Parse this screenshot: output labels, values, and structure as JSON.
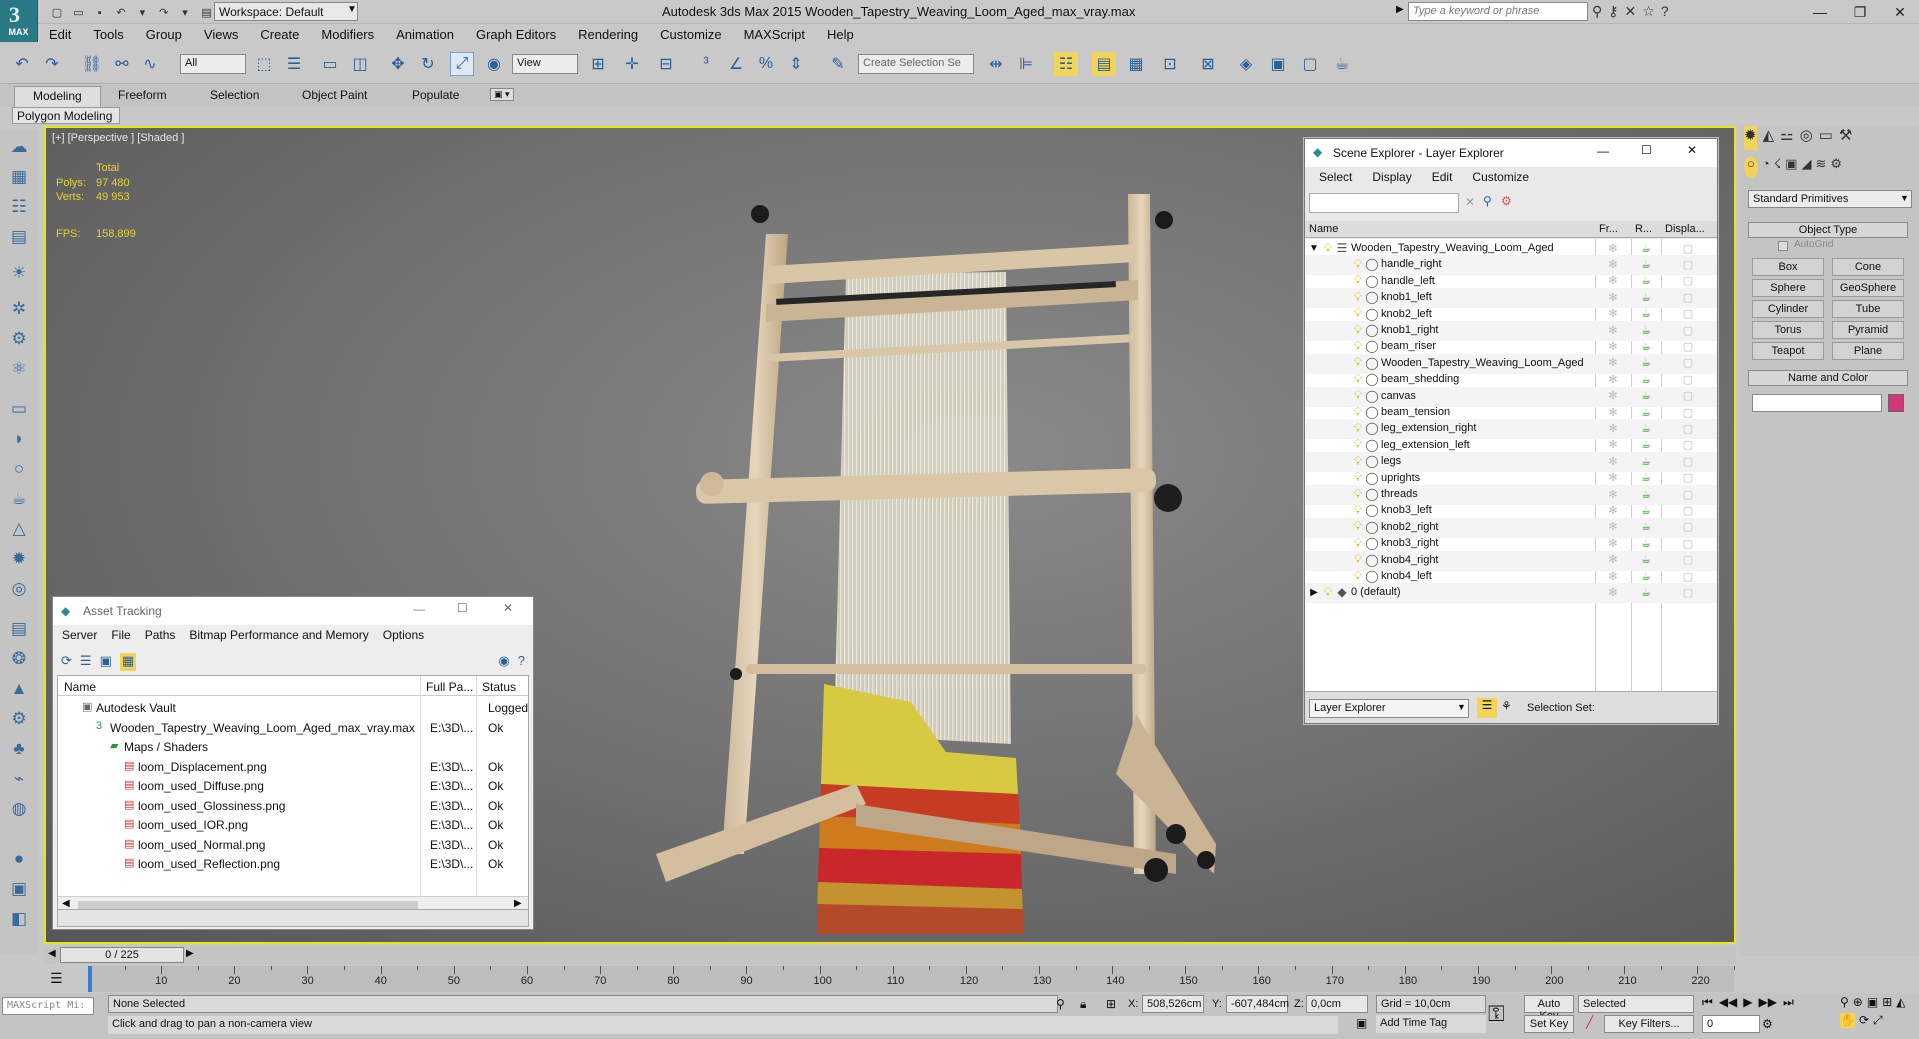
{
  "app": {
    "title": "Autodesk 3ds Max  2015     Wooden_Tapestry_Weaving_Loom_Aged_max_vray.max",
    "logo": "MAX",
    "workspace": "Workspace: Default",
    "search_placeholder": "Type a keyword or phrase"
  },
  "menu": [
    "Edit",
    "Tools",
    "Group",
    "Views",
    "Create",
    "Modifiers",
    "Animation",
    "Graph Editors",
    "Rendering",
    "Customize",
    "MAXScript",
    "Help"
  ],
  "toolbar": {
    "filter": "All",
    "refcoord": "View",
    "selection_set": "Create Selection Se"
  },
  "ribbon": {
    "tabs": [
      "Modeling",
      "Freeform",
      "Selection",
      "Object Paint",
      "Populate"
    ],
    "sub": "Polygon Modeling"
  },
  "viewport": {
    "label": "[+] [Perspective ] [Shaded ]",
    "stats": {
      "total_label": "Total",
      "polys_label": "Polys:",
      "polys": "97 480",
      "verts_label": "Verts:",
      "verts": "49 953",
      "fps_label": "FPS:",
      "fps": "158,899"
    }
  },
  "scene_explorer": {
    "title": "Scene Explorer - Layer Explorer",
    "menu": [
      "Select",
      "Display",
      "Edit",
      "Customize"
    ],
    "columns": {
      "name": "Name",
      "frozen": "Fr...",
      "render": "R...",
      "display": "Displa..."
    },
    "root": "Wooden_Tapestry_Weaving_Loom_Aged",
    "items": [
      "handle_right",
      "handle_left",
      "knob1_left",
      "knob2_left",
      "knob1_right",
      "beam_riser",
      "Wooden_Tapestry_Weaving_Loom_Aged",
      "beam_shedding",
      "canvas",
      "beam_tension",
      "leg_extension_right",
      "leg_extension_left",
      "legs",
      "uprights",
      "threads",
      "knob3_left",
      "knob2_right",
      "knob3_right",
      "knob4_right",
      "knob4_left"
    ],
    "default_layer": "0 (default)",
    "footer_mode": "Layer Explorer",
    "selection_set_label": "Selection Set:"
  },
  "asset_tracking": {
    "title": "Asset Tracking",
    "menu": [
      "Server",
      "File",
      "Paths",
      "Bitmap Performance and Memory",
      "Options"
    ],
    "columns": {
      "name": "Name",
      "full_path": "Full Pa...",
      "status": "Status"
    },
    "rows": [
      {
        "name": "Autodesk Vault",
        "path": "",
        "status": "Logged",
        "indent": 1
      },
      {
        "name": "Wooden_Tapestry_Weaving_Loom_Aged_max_vray.max",
        "path": "E:\\3D\\...",
        "status": "Ok",
        "indent": 2
      },
      {
        "name": "Maps / Shaders",
        "path": "",
        "status": "",
        "indent": 3
      },
      {
        "name": "loom_Displacement.png",
        "path": "E:\\3D\\...",
        "status": "Ok",
        "indent": 4
      },
      {
        "name": "loom_used_Diffuse.png",
        "path": "E:\\3D\\...",
        "status": "Ok",
        "indent": 4
      },
      {
        "name": "loom_used_Glossiness.png",
        "path": "E:\\3D\\...",
        "status": "Ok",
        "indent": 4
      },
      {
        "name": "loom_used_IOR.png",
        "path": "E:\\3D\\...",
        "status": "Ok",
        "indent": 4
      },
      {
        "name": "loom_used_Normal.png",
        "path": "E:\\3D\\...",
        "status": "Ok",
        "indent": 4
      },
      {
        "name": "loom_used_Reflection.png",
        "path": "E:\\3D\\...",
        "status": "Ok",
        "indent": 4
      }
    ]
  },
  "command_panel": {
    "dropdown": "Standard Primitives",
    "object_type_label": "Object Type",
    "autogrid": "AutoGrid",
    "buttons": [
      "Box",
      "Cone",
      "Sphere",
      "GeoSphere",
      "Cylinder",
      "Tube",
      "Torus",
      "Pyramid",
      "Teapot",
      "Plane"
    ],
    "name_color_label": "Name and Color",
    "object_color": "#d4347a"
  },
  "timeline": {
    "frame": "0 / 225",
    "ticks": [
      "10",
      "20",
      "30",
      "40",
      "50",
      "60",
      "70",
      "80",
      "90",
      "100",
      "110",
      "120",
      "130",
      "140",
      "150",
      "160",
      "170",
      "180",
      "190",
      "200",
      "210",
      "220"
    ]
  },
  "status": {
    "maxscript": "MAXScript Mi:",
    "selection": "None Selected",
    "prompt": "Click and drag to pan a non-camera view",
    "x_label": "X:",
    "x": "508,526cm",
    "y_label": "Y:",
    "y": "-607,484cm",
    "z_label": "Z:",
    "z": "0,0cm",
    "grid": "Grid = 10,0cm",
    "add_time_tag": "Add Time Tag",
    "auto_key": "Auto Key",
    "set_key": "Set Key",
    "key_mode": "Selected",
    "key_filters": "Key Filters...",
    "frame_field": "0"
  },
  "colors": {
    "viewport_border": "#e9e21c",
    "stats": "#e3d233",
    "accent": "#2b5f99"
  }
}
